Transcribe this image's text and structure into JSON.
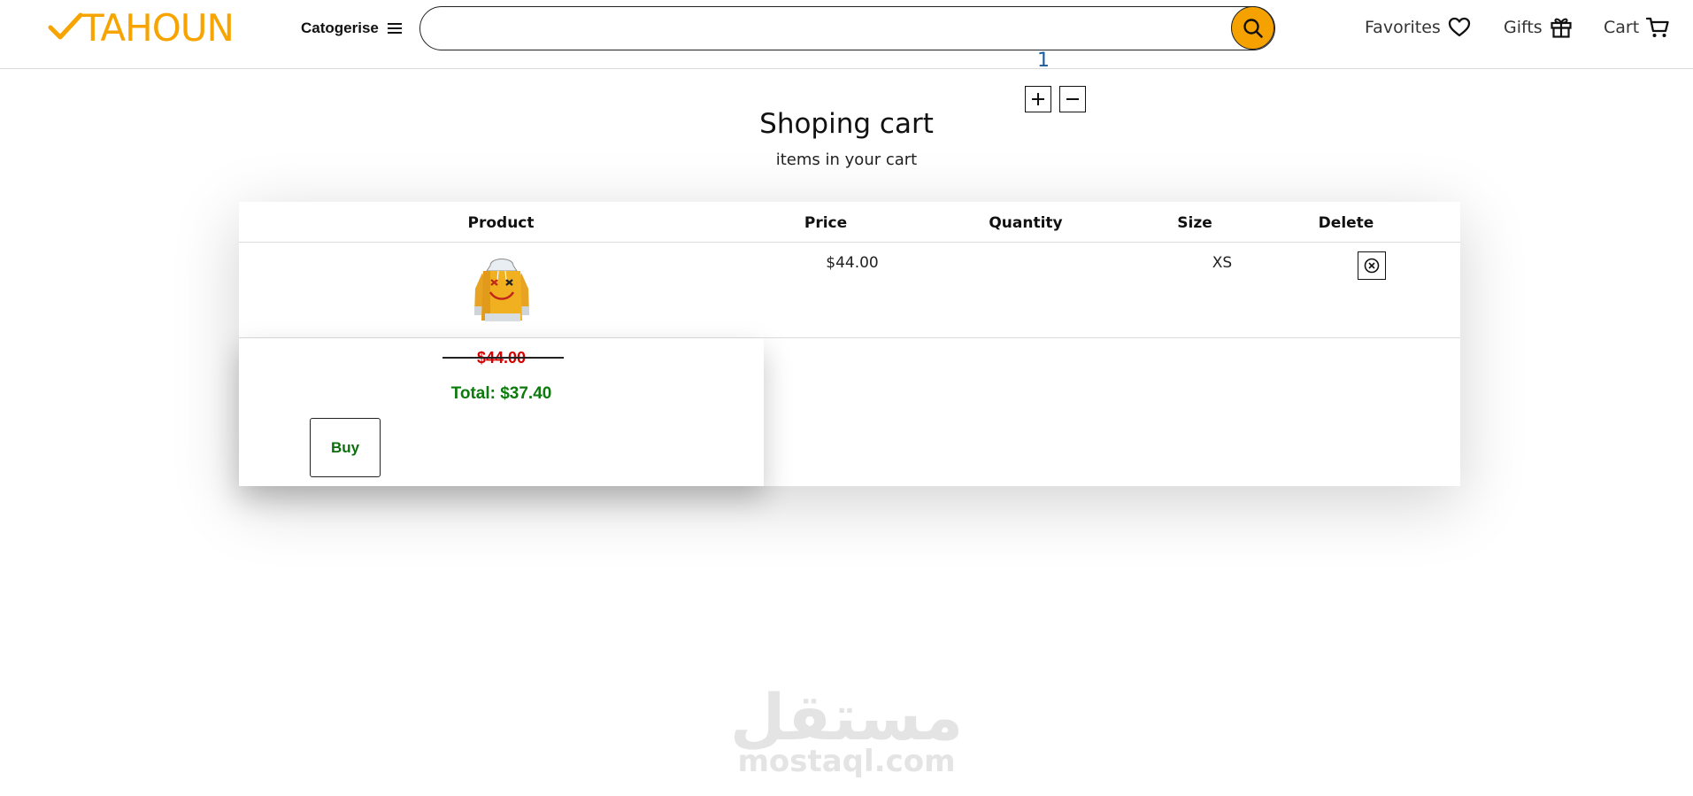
{
  "header": {
    "logo_text": "TAHOUN",
    "categories_label": "Catogerise",
    "search": {
      "value": "",
      "placeholder": ""
    },
    "nav": {
      "favorites_label": "Favorites",
      "gifts_label": "Gifts",
      "cart_label": "Cart"
    }
  },
  "colors": {
    "brand": "#f7a400",
    "search_button": "#f5a200",
    "old_price": "#d40000",
    "total": "#0c7a0c",
    "quantity": "#1c5d99"
  },
  "page": {
    "title": "Shoping cart",
    "subtitle": "items in your cart"
  },
  "cart": {
    "columns": [
      "Product",
      "Price",
      "Quantity",
      "Size",
      "Delete"
    ],
    "items": [
      {
        "image": "yellow-hoodie",
        "price": "$44.00",
        "quantity": "1",
        "size": "XS"
      }
    ],
    "summary": {
      "old_price": "$44.00",
      "total": "Total: $37.40",
      "buy_label": "Buy"
    }
  },
  "watermark": {
    "arabic": "مستقل",
    "latin": "mostaql.com"
  }
}
